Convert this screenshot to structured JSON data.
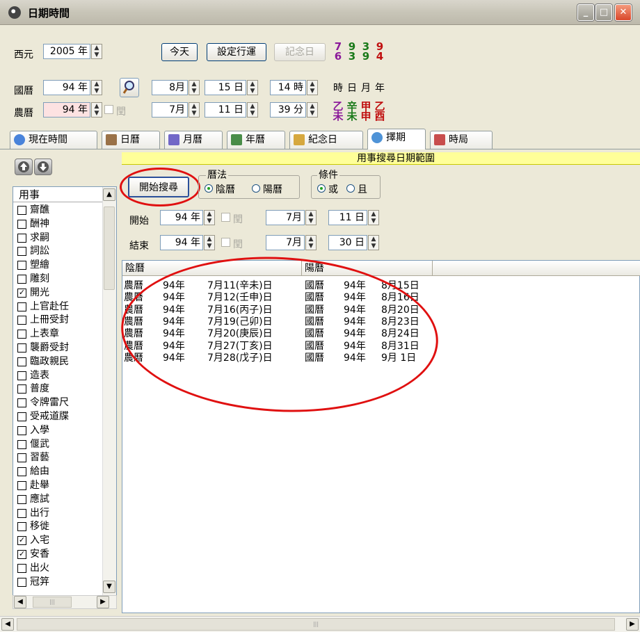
{
  "window": {
    "title": "日期時間",
    "min": "_",
    "max": "□",
    "close": "✕"
  },
  "rows": {
    "western": {
      "label": "西元",
      "year": "2005 年"
    },
    "national": {
      "label": "國曆",
      "year": "94 年",
      "month": "8月",
      "day": "15 日",
      "hour": "14 時"
    },
    "lunar": {
      "label": "農曆",
      "year": "94 年",
      "leap": "閏",
      "month": "7月",
      "day": "11 日",
      "minute": "39 分"
    }
  },
  "buttons": {
    "today": "今天",
    "set_fortune": "設定行運",
    "memorial": "記念日"
  },
  "ganzhi": {
    "numbers": [
      {
        "top": "7",
        "bottom": "6",
        "color": "#8b1a9a"
      },
      {
        "top": "9",
        "bottom": "3",
        "color": "#1a7a1a"
      },
      {
        "top": "3",
        "bottom": "9",
        "color": "#1a7a1a"
      },
      {
        "top": "9",
        "bottom": "4",
        "color": "#c01010"
      }
    ],
    "labels": [
      "時",
      "日",
      "月",
      "年"
    ],
    "stems": [
      {
        "top": "乙",
        "bottom": "未",
        "color": "#8b1a9a"
      },
      {
        "top": "辛",
        "bottom": "未",
        "color": "#1a7a1a"
      },
      {
        "top": "甲",
        "bottom": "申",
        "color": "#c01010"
      },
      {
        "top": "乙",
        "bottom": "酉",
        "color": "#c01010"
      }
    ]
  },
  "tabs": [
    {
      "label": "現在時間",
      "icon": "clock-icon"
    },
    {
      "label": "日曆",
      "icon": "calendar-day-icon"
    },
    {
      "label": "月曆",
      "icon": "calendar-month-icon"
    },
    {
      "label": "年曆",
      "icon": "calendar-grid-icon"
    },
    {
      "label": "紀念日",
      "icon": "people-icon"
    },
    {
      "label": "擇期",
      "icon": "magnifier-icon",
      "active": true
    },
    {
      "label": "時局",
      "icon": "computer-icon"
    }
  ],
  "list": {
    "header": "用事",
    "items": [
      {
        "label": "齋醮",
        "checked": false
      },
      {
        "label": "酬神",
        "checked": false
      },
      {
        "label": "求嗣",
        "checked": false
      },
      {
        "label": "詞訟",
        "checked": false
      },
      {
        "label": "塑繪",
        "checked": false
      },
      {
        "label": "雕刻",
        "checked": false
      },
      {
        "label": "開光",
        "checked": true
      },
      {
        "label": "上官赴任",
        "checked": false
      },
      {
        "label": "上冊受封",
        "checked": false
      },
      {
        "label": "上表章",
        "checked": false
      },
      {
        "label": "襲爵受封",
        "checked": false
      },
      {
        "label": "臨政親民",
        "checked": false
      },
      {
        "label": "造表",
        "checked": false
      },
      {
        "label": "普度",
        "checked": false
      },
      {
        "label": "令牌雷尺",
        "checked": false
      },
      {
        "label": "受戒道牒",
        "checked": false
      },
      {
        "label": "入學",
        "checked": false
      },
      {
        "label": "偃武",
        "checked": false
      },
      {
        "label": "習藝",
        "checked": false
      },
      {
        "label": "給由",
        "checked": false
      },
      {
        "label": "赴舉",
        "checked": false
      },
      {
        "label": "應試",
        "checked": false
      },
      {
        "label": "出行",
        "checked": false
      },
      {
        "label": "移徙",
        "checked": false
      },
      {
        "label": "入宅",
        "checked": true
      },
      {
        "label": "安香",
        "checked": true
      },
      {
        "label": "出火",
        "checked": false
      },
      {
        "label": "冠笄",
        "checked": false
      }
    ]
  },
  "search": {
    "range_title": "用事搜尋日期範圍",
    "start_button": "開始搜尋",
    "calendar_group": {
      "title": "曆法",
      "lunar": "陰曆",
      "solar": "陽曆",
      "selected": "lunar"
    },
    "condition_group": {
      "title": "條件",
      "or": "或",
      "and": "且",
      "selected": "or"
    },
    "start": {
      "label": "開始",
      "year": "94 年",
      "leap": "閏",
      "month": "7月",
      "day": "11 日"
    },
    "end": {
      "label": "結束",
      "year": "94 年",
      "leap": "閏",
      "month": "7月",
      "day": "30 日"
    }
  },
  "results": {
    "columns": [
      "陰曆",
      "陽曆"
    ],
    "rows": [
      [
        "農曆",
        "94年",
        "7月11(辛未)日",
        "國曆",
        "94年",
        "8月15日"
      ],
      [
        "農曆",
        "94年",
        "7月12(壬申)日",
        "國曆",
        "94年",
        "8月16日"
      ],
      [
        "農曆",
        "94年",
        "7月16(丙子)日",
        "國曆",
        "94年",
        "8月20日"
      ],
      [
        "農曆",
        "94年",
        "7月19(己卯)日",
        "國曆",
        "94年",
        "8月23日"
      ],
      [
        "農曆",
        "94年",
        "7月20(庚辰)日",
        "國曆",
        "94年",
        "8月24日"
      ],
      [
        "農曆",
        "94年",
        "7月27(丁亥)日",
        "國曆",
        "94年",
        "8月31日"
      ],
      [
        "農曆",
        "94年",
        "7月28(戊子)日",
        "國曆",
        "94年",
        "9月 1日"
      ]
    ]
  },
  "scroll": {
    "up": "▲",
    "down": "▼",
    "left": "◀",
    "right": "▶",
    "thumb": "|||"
  }
}
